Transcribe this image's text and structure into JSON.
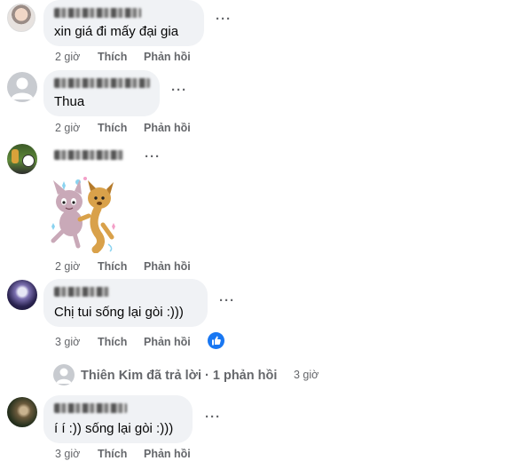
{
  "comments": [
    {
      "text": "xin giá đi mấy đại gia",
      "time": "2 giờ",
      "like_label": "Thích",
      "reply_label": "Phản hồi",
      "more": "···"
    },
    {
      "text": "Thua",
      "time": "2 giờ",
      "like_label": "Thích",
      "reply_label": "Phản hồi",
      "more": "···"
    },
    {
      "text": "",
      "time": "2 giờ",
      "like_label": "Thích",
      "reply_label": "Phản hồi",
      "more": "···",
      "sticker": "dancing-cat-dog-sticker"
    },
    {
      "text": "Chị tui sống lại gòi :)))",
      "time": "3 giờ",
      "like_label": "Thích",
      "reply_label": "Phản hồi",
      "more": "···",
      "reaction": "like-reaction-icon"
    },
    {
      "text": "í í :)) sống lại gòi :)))",
      "time": "3 giờ",
      "like_label": "Thích",
      "reply_label": "Phản hồi",
      "more": "···"
    }
  ],
  "reply_thread": {
    "text": "Thiên Kim đã trả lời · 1 phản hồi",
    "time": "3 giờ"
  },
  "colors": {
    "meta": "#65676b",
    "bubble": "#f0f2f5",
    "like_blue": "#1877f2"
  }
}
